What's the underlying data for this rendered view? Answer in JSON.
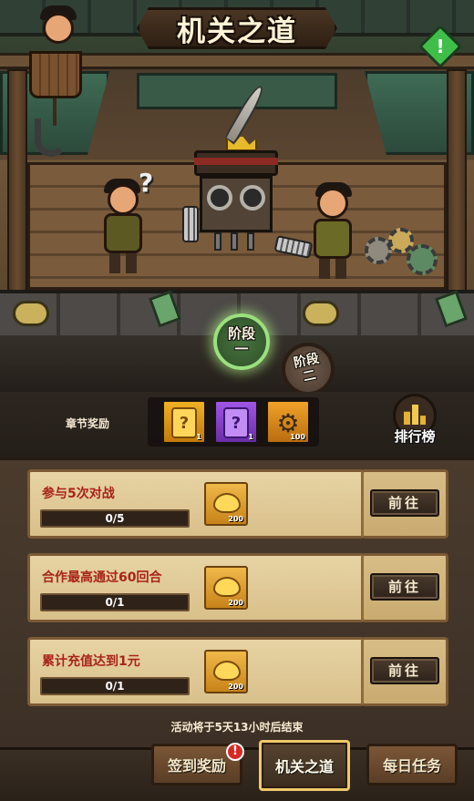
{
  "header": {
    "title": "机关之道",
    "alert_icon": "!"
  },
  "scene": {
    "question_mark": "?"
  },
  "stages": [
    {
      "line1": "阶段",
      "line2": "一",
      "state": "active"
    },
    {
      "line1": "阶段",
      "line2": "二",
      "state": "locked"
    }
  ],
  "chapter_rewards": {
    "label": "章节奖励",
    "items": [
      {
        "icon": "gold-card-icon",
        "glyph": "?",
        "count": "1",
        "color": "#f0b024"
      },
      {
        "icon": "purple-card-icon",
        "glyph": "?",
        "count": "1",
        "color": "#a055e6"
      },
      {
        "icon": "gear-icon",
        "glyph": "⚙",
        "count": "100",
        "color": "#f0a228"
      }
    ]
  },
  "leaderboard": {
    "label": "排行榜"
  },
  "tasks": [
    {
      "name": "参与5次对战",
      "progress_text": "0/5",
      "progress": 0,
      "reward_icon": "gold-ingot-icon",
      "reward_count": "200",
      "button": "前往"
    },
    {
      "name": "合作最高通过60回合",
      "progress_text": "0/1",
      "progress": 0,
      "reward_icon": "gold-ingot-icon",
      "reward_count": "200",
      "button": "前往"
    },
    {
      "name": "累计充值达到1元",
      "progress_text": "0/1",
      "progress": 0,
      "reward_icon": "gold-ingot-icon",
      "reward_count": "200",
      "button": "前往"
    }
  ],
  "countdown": "活动将于5天13小时后结束",
  "tabs": [
    {
      "label": "签到奖励",
      "active": false,
      "badge": "!"
    },
    {
      "label": "机关之道",
      "active": true
    },
    {
      "label": "每日任务",
      "active": false
    }
  ],
  "colors": {
    "task_title": "#a8231b",
    "active_tab_border": "#f0c86a",
    "stage_active_glow": "#9be07f"
  }
}
